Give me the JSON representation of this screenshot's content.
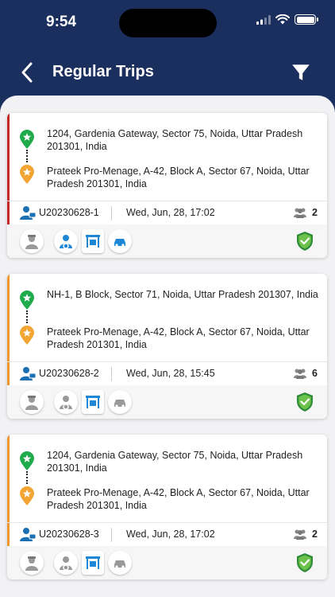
{
  "status": {
    "time": "9:54"
  },
  "header": {
    "title": "Regular Trips"
  },
  "colors": {
    "accent_red": "#c62828",
    "accent_orange": "#f0962e",
    "pickup_green": "#1faa4b",
    "drop_orange": "#f3a533",
    "shield_green": "#2e8b3a",
    "blue": "#1e88d6"
  },
  "trips": [
    {
      "pickup": "1204, Gardenia Gateway, Sector 75, Noida, Uttar Pradesh 201301, India",
      "drop": "Prateek Pro-Menage, A-42, Block A, Sector 67, Noida, Uttar Pradesh 201301, India",
      "id": "U20230628-1",
      "datetime": "Wed, Jun, 28, 17:02",
      "passengers": "2"
    },
    {
      "pickup": "NH-1, B Block, Sector 71, Noida, Uttar Pradesh 201307, India",
      "drop": "Prateek Pro-Menage, A-42, Block A, Sector 67, Noida, Uttar Pradesh 201301, India",
      "id": "U20230628-2",
      "datetime": "Wed, Jun, 28, 15:45",
      "passengers": "6"
    },
    {
      "pickup": "1204, Gardenia Gateway, Sector 75, Noida, Uttar Pradesh 201301, India",
      "drop": "Prateek Pro-Menage, A-42, Block A, Sector 67, Noida, Uttar Pradesh 201301, India",
      "id": "U20230628-3",
      "datetime": "Wed, Jun, 28, 17:02",
      "passengers": "2"
    }
  ]
}
